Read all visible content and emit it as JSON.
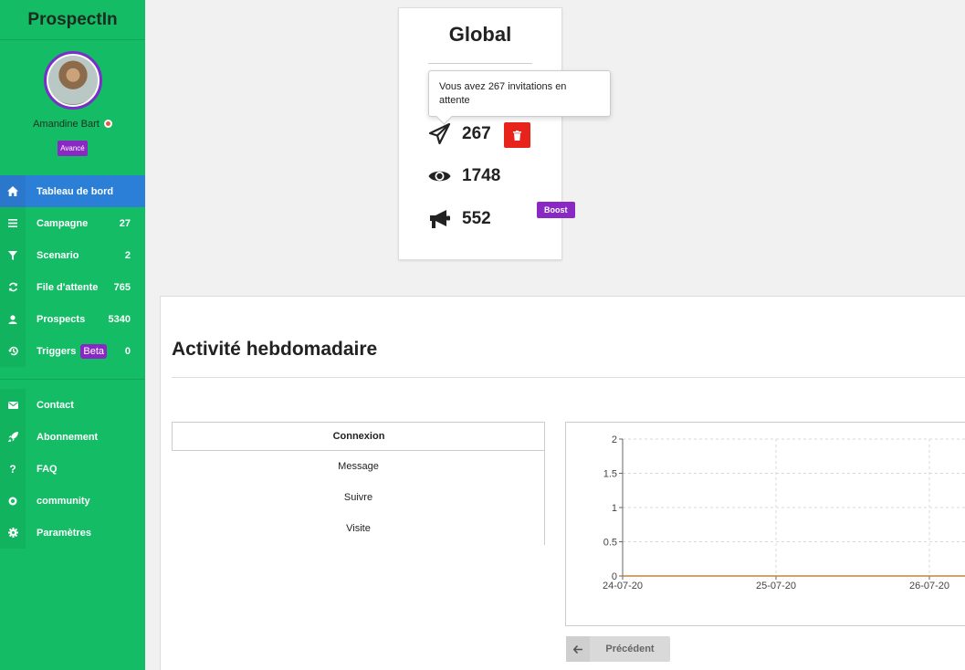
{
  "sidebar": {
    "brand": "ProspectIn",
    "user_name": "Amandine Bart",
    "level_badge": "Avancé",
    "items": [
      {
        "label": "Tableau de bord",
        "count": ""
      },
      {
        "label": "Campagne",
        "count": "27"
      },
      {
        "label": "Scenario",
        "count": "2"
      },
      {
        "label": "File d'attente",
        "count": "765"
      },
      {
        "label": "Prospects",
        "count": "5340"
      },
      {
        "label": "Triggers",
        "badge": "Beta",
        "count": "0"
      }
    ],
    "secondary": [
      {
        "label": "Contact"
      },
      {
        "label": "Abonnement"
      },
      {
        "label": "FAQ"
      },
      {
        "label": "community"
      },
      {
        "label": "Paramètres"
      }
    ]
  },
  "global": {
    "title": "Global",
    "tooltip": "Vous avez 267 invitations en attente",
    "invitations": "267",
    "views": "1748",
    "messages": "552",
    "boost_label": "Boost"
  },
  "activity": {
    "title": "Activité hebdomadaire",
    "tabs": [
      "Connexion",
      "Message",
      "Suivre",
      "Visite"
    ],
    "prev_label": "Précédent"
  },
  "chart_data": {
    "type": "line",
    "x": [
      "24-07-20",
      "25-07-20",
      "26-07-20"
    ],
    "series": [
      {
        "values": [
          0,
          0,
          0
        ]
      }
    ],
    "ylim": [
      0,
      2
    ],
    "yticks": [
      "0",
      "0.5",
      "1",
      "1.5",
      "2"
    ],
    "grid": true,
    "color": "#c9843a"
  },
  "colors": {
    "sidebar": "#14bd65",
    "active": "#2c7fd6",
    "purple": "#8a28c4",
    "danger": "#e8231c"
  }
}
